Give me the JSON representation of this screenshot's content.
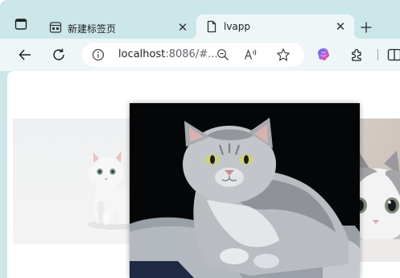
{
  "browser": {
    "tabs": [
      {
        "title": "新建标签页",
        "active": false,
        "icon": "new-tab-page-icon"
      },
      {
        "title": "lvapp",
        "active": true,
        "icon": "page-icon"
      }
    ],
    "address": {
      "host": "localhost",
      "rest": ":8086/#..."
    }
  },
  "content": {
    "carousel": [
      {
        "subject": "white-kitten",
        "position": "left"
      },
      {
        "subject": "grey-british-shorthair-cat",
        "position": "center"
      },
      {
        "subject": "white-grey-cat",
        "position": "right"
      }
    ]
  },
  "colors": {
    "tabstrip": "#cce7e9",
    "toolbar": "#eef6f7",
    "center_bg": "#050607"
  }
}
